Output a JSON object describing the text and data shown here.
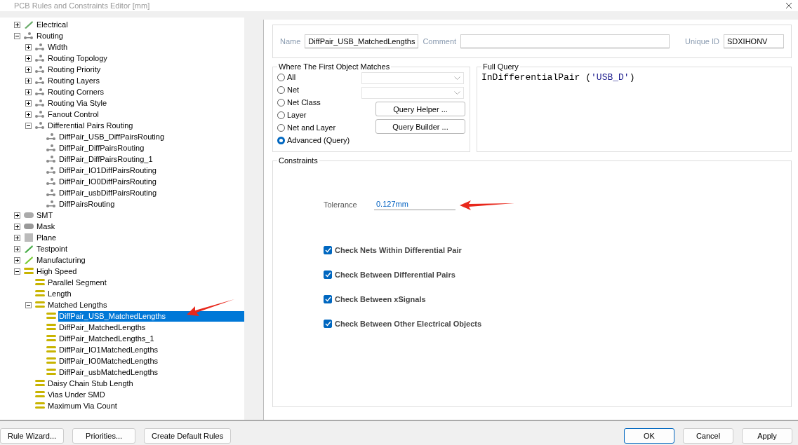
{
  "window": {
    "title": "PCB Rules and Constraints Editor [mm]"
  },
  "tree": [
    {
      "label": "Electrical",
      "kind": "electrical",
      "expanded": false,
      "selected": false
    },
    {
      "label": "Routing",
      "kind": "routing",
      "expanded": true,
      "selected": false,
      "children": [
        {
          "label": "Width",
          "kind": "routing",
          "expanded": false,
          "selected": false
        },
        {
          "label": "Routing Topology",
          "kind": "routing",
          "expanded": false,
          "selected": false
        },
        {
          "label": "Routing Priority",
          "kind": "routing",
          "expanded": false,
          "selected": false
        },
        {
          "label": "Routing Layers",
          "kind": "routing",
          "expanded": false,
          "selected": false
        },
        {
          "label": "Routing Corners",
          "kind": "routing",
          "expanded": false,
          "selected": false
        },
        {
          "label": "Routing Via Style",
          "kind": "routing",
          "expanded": false,
          "selected": false
        },
        {
          "label": "Fanout Control",
          "kind": "routing",
          "expanded": false,
          "selected": false
        },
        {
          "label": "Differential Pairs Routing",
          "kind": "routing",
          "expanded": true,
          "selected": false,
          "children": [
            {
              "label": "DiffPair_USB_DiffPairsRouting",
              "kind": "routing",
              "selected": false
            },
            {
              "label": "DiffPair_DiffPairsRouting",
              "kind": "routing",
              "selected": false
            },
            {
              "label": "DiffPair_DiffPairsRouting_1",
              "kind": "routing",
              "selected": false
            },
            {
              "label": "DiffPair_IO1DiffPairsRouting",
              "kind": "routing",
              "selected": false
            },
            {
              "label": "DiffPair_IO0DiffPairsRouting",
              "kind": "routing",
              "selected": false
            },
            {
              "label": "DiffPair_usbDiffPairsRouting",
              "kind": "routing",
              "selected": false
            },
            {
              "label": "DiffPairsRouting",
              "kind": "routing",
              "selected": false
            }
          ]
        }
      ]
    },
    {
      "label": "SMT",
      "kind": "smt",
      "expanded": false,
      "selected": false
    },
    {
      "label": "Mask",
      "kind": "mask",
      "expanded": false,
      "selected": false
    },
    {
      "label": "Plane",
      "kind": "plane",
      "expanded": false,
      "selected": false
    },
    {
      "label": "Testpoint",
      "kind": "testpoint",
      "expanded": false,
      "selected": false
    },
    {
      "label": "Manufacturing",
      "kind": "manufacturing",
      "expanded": false,
      "selected": false
    },
    {
      "label": "High Speed",
      "kind": "highspeed",
      "expanded": true,
      "selected": false,
      "children": [
        {
          "label": "Parallel Segment",
          "kind": "highspeed",
          "selected": false
        },
        {
          "label": "Length",
          "kind": "highspeed",
          "selected": false
        },
        {
          "label": "Matched Lengths",
          "kind": "highspeed",
          "expanded": true,
          "selected": false,
          "children": [
            {
              "label": "DiffPair_USB_MatchedLengths",
              "kind": "highspeed",
              "selected": true
            },
            {
              "label": "DiffPair_MatchedLengths",
              "kind": "highspeed",
              "selected": false
            },
            {
              "label": "DiffPair_MatchedLengths_1",
              "kind": "highspeed",
              "selected": false
            },
            {
              "label": "DiffPair_IO1MatchedLengths",
              "kind": "highspeed",
              "selected": false
            },
            {
              "label": "DiffPair_IO0MatchedLengths",
              "kind": "highspeed",
              "selected": false
            },
            {
              "label": "DiffPair_usbMatchedLengths",
              "kind": "highspeed",
              "selected": false
            }
          ]
        },
        {
          "label": "Daisy Chain Stub Length",
          "kind": "highspeed",
          "selected": false
        },
        {
          "label": "Vias Under SMD",
          "kind": "highspeed",
          "selected": false
        },
        {
          "label": "Maximum Via Count",
          "kind": "highspeed",
          "selected": false
        }
      ]
    }
  ],
  "rule": {
    "name_label": "Name",
    "name": "DiffPair_USB_MatchedLengths",
    "comment_label": "Comment",
    "id_label": "Unique ID",
    "unique_id": "SDXIHONV"
  },
  "match": {
    "title": "Where The First Object Matches",
    "options": [
      {
        "label": "All",
        "selected": false
      },
      {
        "label": "Net",
        "selected": false
      },
      {
        "label": "Net Class",
        "selected": false
      },
      {
        "label": "Layer",
        "selected": false
      },
      {
        "label": "Net and Layer",
        "selected": false
      },
      {
        "label": "Advanced (Query)",
        "selected": true
      }
    ],
    "buttons": [
      "Query Helper ...",
      "Query Builder ..."
    ]
  },
  "query": {
    "title": "Full Query",
    "parts": [
      {
        "text": "InDifferentialPair (",
        "kind": "code"
      },
      {
        "text": "'USB_D'",
        "kind": "string"
      },
      {
        "text": ")",
        "kind": "code"
      }
    ]
  },
  "constraints": {
    "title": "Constraints",
    "tolerance_label": "Tolerance",
    "tolerance": "0.127mm",
    "checks": [
      {
        "label": "Check Nets Within Differential Pair",
        "checked": true
      },
      {
        "label": "Check Between Differential Pairs",
        "checked": true
      },
      {
        "label": "Check Between xSignals",
        "checked": true
      },
      {
        "label": "Check Between Other Electrical Objects",
        "checked": true
      }
    ]
  },
  "buttons_left": [
    "Rule Wizard...",
    "Priorities...",
    "Create Default Rules"
  ],
  "buttons_right": [
    "OK",
    "Cancel",
    "Apply"
  ]
}
